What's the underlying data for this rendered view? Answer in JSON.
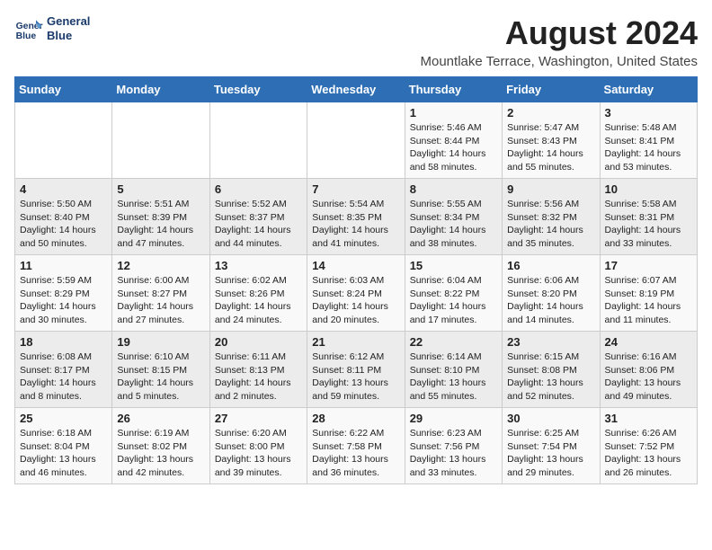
{
  "header": {
    "logo_line1": "General",
    "logo_line2": "Blue",
    "main_title": "August 2024",
    "subtitle": "Mountlake Terrace, Washington, United States"
  },
  "days_of_week": [
    "Sunday",
    "Monday",
    "Tuesday",
    "Wednesday",
    "Thursday",
    "Friday",
    "Saturday"
  ],
  "weeks": [
    [
      {
        "day": "",
        "info": ""
      },
      {
        "day": "",
        "info": ""
      },
      {
        "day": "",
        "info": ""
      },
      {
        "day": "",
        "info": ""
      },
      {
        "day": "1",
        "info": "Sunrise: 5:46 AM\nSunset: 8:44 PM\nDaylight: 14 hours\nand 58 minutes."
      },
      {
        "day": "2",
        "info": "Sunrise: 5:47 AM\nSunset: 8:43 PM\nDaylight: 14 hours\nand 55 minutes."
      },
      {
        "day": "3",
        "info": "Sunrise: 5:48 AM\nSunset: 8:41 PM\nDaylight: 14 hours\nand 53 minutes."
      }
    ],
    [
      {
        "day": "4",
        "info": "Sunrise: 5:50 AM\nSunset: 8:40 PM\nDaylight: 14 hours\nand 50 minutes."
      },
      {
        "day": "5",
        "info": "Sunrise: 5:51 AM\nSunset: 8:39 PM\nDaylight: 14 hours\nand 47 minutes."
      },
      {
        "day": "6",
        "info": "Sunrise: 5:52 AM\nSunset: 8:37 PM\nDaylight: 14 hours\nand 44 minutes."
      },
      {
        "day": "7",
        "info": "Sunrise: 5:54 AM\nSunset: 8:35 PM\nDaylight: 14 hours\nand 41 minutes."
      },
      {
        "day": "8",
        "info": "Sunrise: 5:55 AM\nSunset: 8:34 PM\nDaylight: 14 hours\nand 38 minutes."
      },
      {
        "day": "9",
        "info": "Sunrise: 5:56 AM\nSunset: 8:32 PM\nDaylight: 14 hours\nand 35 minutes."
      },
      {
        "day": "10",
        "info": "Sunrise: 5:58 AM\nSunset: 8:31 PM\nDaylight: 14 hours\nand 33 minutes."
      }
    ],
    [
      {
        "day": "11",
        "info": "Sunrise: 5:59 AM\nSunset: 8:29 PM\nDaylight: 14 hours\nand 30 minutes."
      },
      {
        "day": "12",
        "info": "Sunrise: 6:00 AM\nSunset: 8:27 PM\nDaylight: 14 hours\nand 27 minutes."
      },
      {
        "day": "13",
        "info": "Sunrise: 6:02 AM\nSunset: 8:26 PM\nDaylight: 14 hours\nand 24 minutes."
      },
      {
        "day": "14",
        "info": "Sunrise: 6:03 AM\nSunset: 8:24 PM\nDaylight: 14 hours\nand 20 minutes."
      },
      {
        "day": "15",
        "info": "Sunrise: 6:04 AM\nSunset: 8:22 PM\nDaylight: 14 hours\nand 17 minutes."
      },
      {
        "day": "16",
        "info": "Sunrise: 6:06 AM\nSunset: 8:20 PM\nDaylight: 14 hours\nand 14 minutes."
      },
      {
        "day": "17",
        "info": "Sunrise: 6:07 AM\nSunset: 8:19 PM\nDaylight: 14 hours\nand 11 minutes."
      }
    ],
    [
      {
        "day": "18",
        "info": "Sunrise: 6:08 AM\nSunset: 8:17 PM\nDaylight: 14 hours\nand 8 minutes."
      },
      {
        "day": "19",
        "info": "Sunrise: 6:10 AM\nSunset: 8:15 PM\nDaylight: 14 hours\nand 5 minutes."
      },
      {
        "day": "20",
        "info": "Sunrise: 6:11 AM\nSunset: 8:13 PM\nDaylight: 14 hours\nand 2 minutes."
      },
      {
        "day": "21",
        "info": "Sunrise: 6:12 AM\nSunset: 8:11 PM\nDaylight: 13 hours\nand 59 minutes."
      },
      {
        "day": "22",
        "info": "Sunrise: 6:14 AM\nSunset: 8:10 PM\nDaylight: 13 hours\nand 55 minutes."
      },
      {
        "day": "23",
        "info": "Sunrise: 6:15 AM\nSunset: 8:08 PM\nDaylight: 13 hours\nand 52 minutes."
      },
      {
        "day": "24",
        "info": "Sunrise: 6:16 AM\nSunset: 8:06 PM\nDaylight: 13 hours\nand 49 minutes."
      }
    ],
    [
      {
        "day": "25",
        "info": "Sunrise: 6:18 AM\nSunset: 8:04 PM\nDaylight: 13 hours\nand 46 minutes."
      },
      {
        "day": "26",
        "info": "Sunrise: 6:19 AM\nSunset: 8:02 PM\nDaylight: 13 hours\nand 42 minutes."
      },
      {
        "day": "27",
        "info": "Sunrise: 6:20 AM\nSunset: 8:00 PM\nDaylight: 13 hours\nand 39 minutes."
      },
      {
        "day": "28",
        "info": "Sunrise: 6:22 AM\nSunset: 7:58 PM\nDaylight: 13 hours\nand 36 minutes."
      },
      {
        "day": "29",
        "info": "Sunrise: 6:23 AM\nSunset: 7:56 PM\nDaylight: 13 hours\nand 33 minutes."
      },
      {
        "day": "30",
        "info": "Sunrise: 6:25 AM\nSunset: 7:54 PM\nDaylight: 13 hours\nand 29 minutes."
      },
      {
        "day": "31",
        "info": "Sunrise: 6:26 AM\nSunset: 7:52 PM\nDaylight: 13 hours\nand 26 minutes."
      }
    ]
  ]
}
